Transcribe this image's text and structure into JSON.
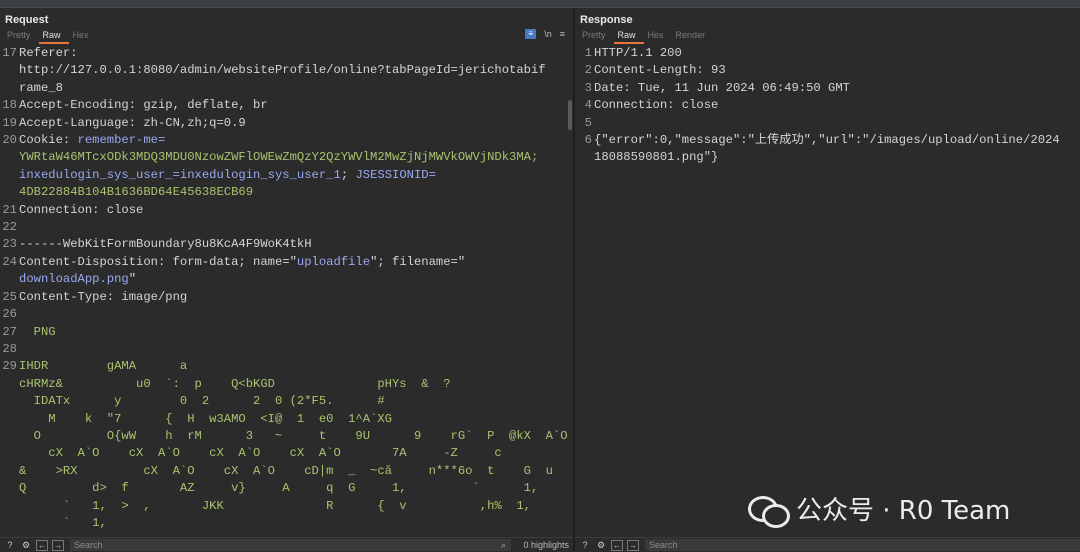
{
  "request": {
    "title": "Request",
    "tabs": [
      "Pretty",
      "Raw",
      "Hex"
    ],
    "active_tab": "Raw",
    "tool_labels": [
      "\\n",
      "≡"
    ],
    "lines": [
      {
        "n": "17",
        "parts": [
          [
            "Referer:",
            "w"
          ]
        ]
      },
      {
        "n": "",
        "parts": [
          [
            "http://127.0.0.1:8080/admin/websiteProfile/online?tabPageId=jerichotabif",
            "w"
          ]
        ]
      },
      {
        "n": "",
        "parts": [
          [
            "rame_8",
            "w"
          ]
        ]
      },
      {
        "n": "18",
        "parts": [
          [
            "Accept-Encoding: gzip, deflate, br",
            "w"
          ]
        ]
      },
      {
        "n": "19",
        "parts": [
          [
            "Accept-Language: zh-CN,zh;q=0.9",
            "w"
          ]
        ]
      },
      {
        "n": "20",
        "parts": [
          [
            "Cookie: ",
            "w"
          ],
          [
            "remember-me=",
            "b"
          ]
        ]
      },
      {
        "n": "",
        "parts": [
          [
            "YWRtaW46MTcxODk3MDQ3MDU0NzowZWFlOWEwZmQzY2QzYWVlM2MwZjNjMWVkOWVjNDk3MA;",
            "g"
          ]
        ]
      },
      {
        "n": "",
        "parts": [
          [
            "inxedulogin_sys_user_=inxedulogin_sys_user_1",
            "b"
          ],
          [
            "; ",
            "w"
          ],
          [
            "JSESSIONID=",
            "b"
          ]
        ]
      },
      {
        "n": "",
        "parts": [
          [
            "4DB22884B104B1636BD64E45638ECB69",
            "g"
          ]
        ]
      },
      {
        "n": "21",
        "parts": [
          [
            "Connection: close",
            "w"
          ]
        ]
      },
      {
        "n": "22",
        "parts": [
          [
            "",
            "w"
          ]
        ]
      },
      {
        "n": "23",
        "parts": [
          [
            "------WebKitFormBoundary8u8KcA4F9WoK4tkH",
            "w"
          ]
        ]
      },
      {
        "n": "24",
        "parts": [
          [
            "Content-Disposition: form-data; name=\"",
            "w"
          ],
          [
            "uploadfile",
            "b"
          ],
          [
            "\"; filename=\"",
            "w"
          ]
        ]
      },
      {
        "n": "",
        "parts": [
          [
            "downloadApp.png",
            "b"
          ],
          [
            "\"",
            "w"
          ]
        ]
      },
      {
        "n": "25",
        "parts": [
          [
            "Content-Type: image/png",
            "w"
          ]
        ]
      },
      {
        "n": "26",
        "parts": [
          [
            "",
            "w"
          ]
        ]
      },
      {
        "n": "27",
        "parts": [
          [
            "  PNG",
            "g"
          ]
        ]
      },
      {
        "n": "28",
        "parts": [
          [
            "",
            "w"
          ]
        ]
      },
      {
        "n": "29",
        "parts": [
          [
            "IHDR        gAMA      a",
            "g"
          ]
        ]
      },
      {
        "n": "",
        "parts": [
          [
            "cHRMz&          u0  `:  p    Q<bKGD              pHYs  &  ?",
            "g"
          ]
        ]
      },
      {
        "n": "",
        "parts": [
          [
            "  IDATx      y        0  2      2  0 (2*F5.      #",
            "g"
          ]
        ]
      },
      {
        "n": "",
        "parts": [
          [
            "    M    k  \"7      {  H  w3AMO  <I@  1  e0  1^A`XG",
            "g"
          ]
        ]
      },
      {
        "n": "",
        "parts": [
          [
            "  O         O{wW    h  rM      3   ~     t    9U      9    rG`  P  @kX  A`O",
            "g"
          ]
        ]
      },
      {
        "n": "",
        "parts": [
          [
            "    cX  A`O    cX  A`O    cX  A`O    cX  A`O       7A     -Z     c",
            "g"
          ]
        ]
      },
      {
        "n": "",
        "parts": [
          [
            "&    >RX         cX  A`O    cX  A`O    cD|m  _  ~cǎ     n***6o  t    G  u",
            "g"
          ]
        ]
      },
      {
        "n": "",
        "parts": [
          [
            "Q         d>  f       AZ     v}     A     q  G     1,         `      1,",
            "g"
          ]
        ]
      },
      {
        "n": "",
        "parts": [
          [
            "      `   1,  >  ,       JKK              R      {  v          ,h%  1,",
            "g"
          ]
        ]
      },
      {
        "n": "",
        "parts": [
          [
            "      `   1,",
            "g"
          ]
        ]
      }
    ],
    "search_placeholder": "Search",
    "highlights": "0 highlights"
  },
  "response": {
    "title": "Response",
    "tabs": [
      "Pretty",
      "Raw",
      "Hex",
      "Render"
    ],
    "active_tab": "Raw",
    "lines": [
      {
        "n": "1",
        "parts": [
          [
            "HTTP/1.1 200",
            "w"
          ]
        ]
      },
      {
        "n": "2",
        "parts": [
          [
            "Content-Length: 93",
            "w"
          ]
        ]
      },
      {
        "n": "3",
        "parts": [
          [
            "Date: Tue, 11 Jun 2024 06:49:50 GMT",
            "w"
          ]
        ]
      },
      {
        "n": "4",
        "parts": [
          [
            "Connection: close",
            "w"
          ]
        ]
      },
      {
        "n": "5",
        "parts": [
          [
            "",
            "w"
          ]
        ]
      },
      {
        "n": "6",
        "parts": [
          [
            "{\"error\":0,\"message\":\"上传成功\",\"url\":\"/images/upload/online/2024",
            "w"
          ]
        ]
      },
      {
        "n": "",
        "parts": [
          [
            "18088590801.png\"}",
            "w"
          ]
        ]
      }
    ],
    "search_placeholder": "Search"
  },
  "watermark": "公众号 · R0 Team",
  "colors": {
    "accent": "#e8743b",
    "green": "#a8c36e",
    "blue": "#9aa8ef"
  }
}
